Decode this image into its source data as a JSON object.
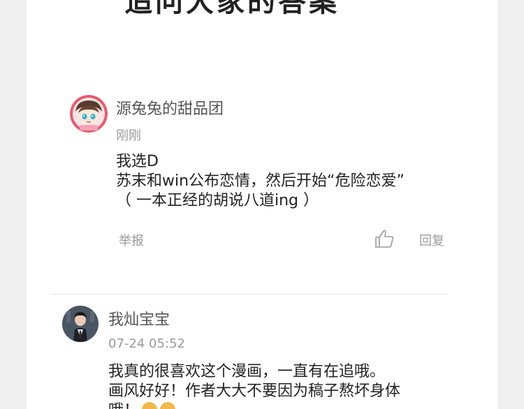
{
  "header": {
    "title_cutoff": "追问大家的答案"
  },
  "comments": [
    {
      "username": "源兔兔的甜品团",
      "time": "刚刚",
      "lines": [
        "我选D",
        "苏末和win公布恋情，然后开始“危险恋爱”",
        "（ 一本正经的胡说八道ing ）"
      ],
      "report_label": "举报",
      "reply_label": "回复",
      "like_icon": "thumbs-up-icon"
    },
    {
      "username": "我灿宝宝",
      "time": "07-24 05:52",
      "lines": [
        " 我真的很喜欢这个漫画，一直有在追哦。",
        "画风好好！作者大大不要因为稿子熬坏身体",
        "哦！"
      ]
    }
  ],
  "colors": {
    "background": "#efefef",
    "card": "#ffffff",
    "muted": "#999999"
  }
}
